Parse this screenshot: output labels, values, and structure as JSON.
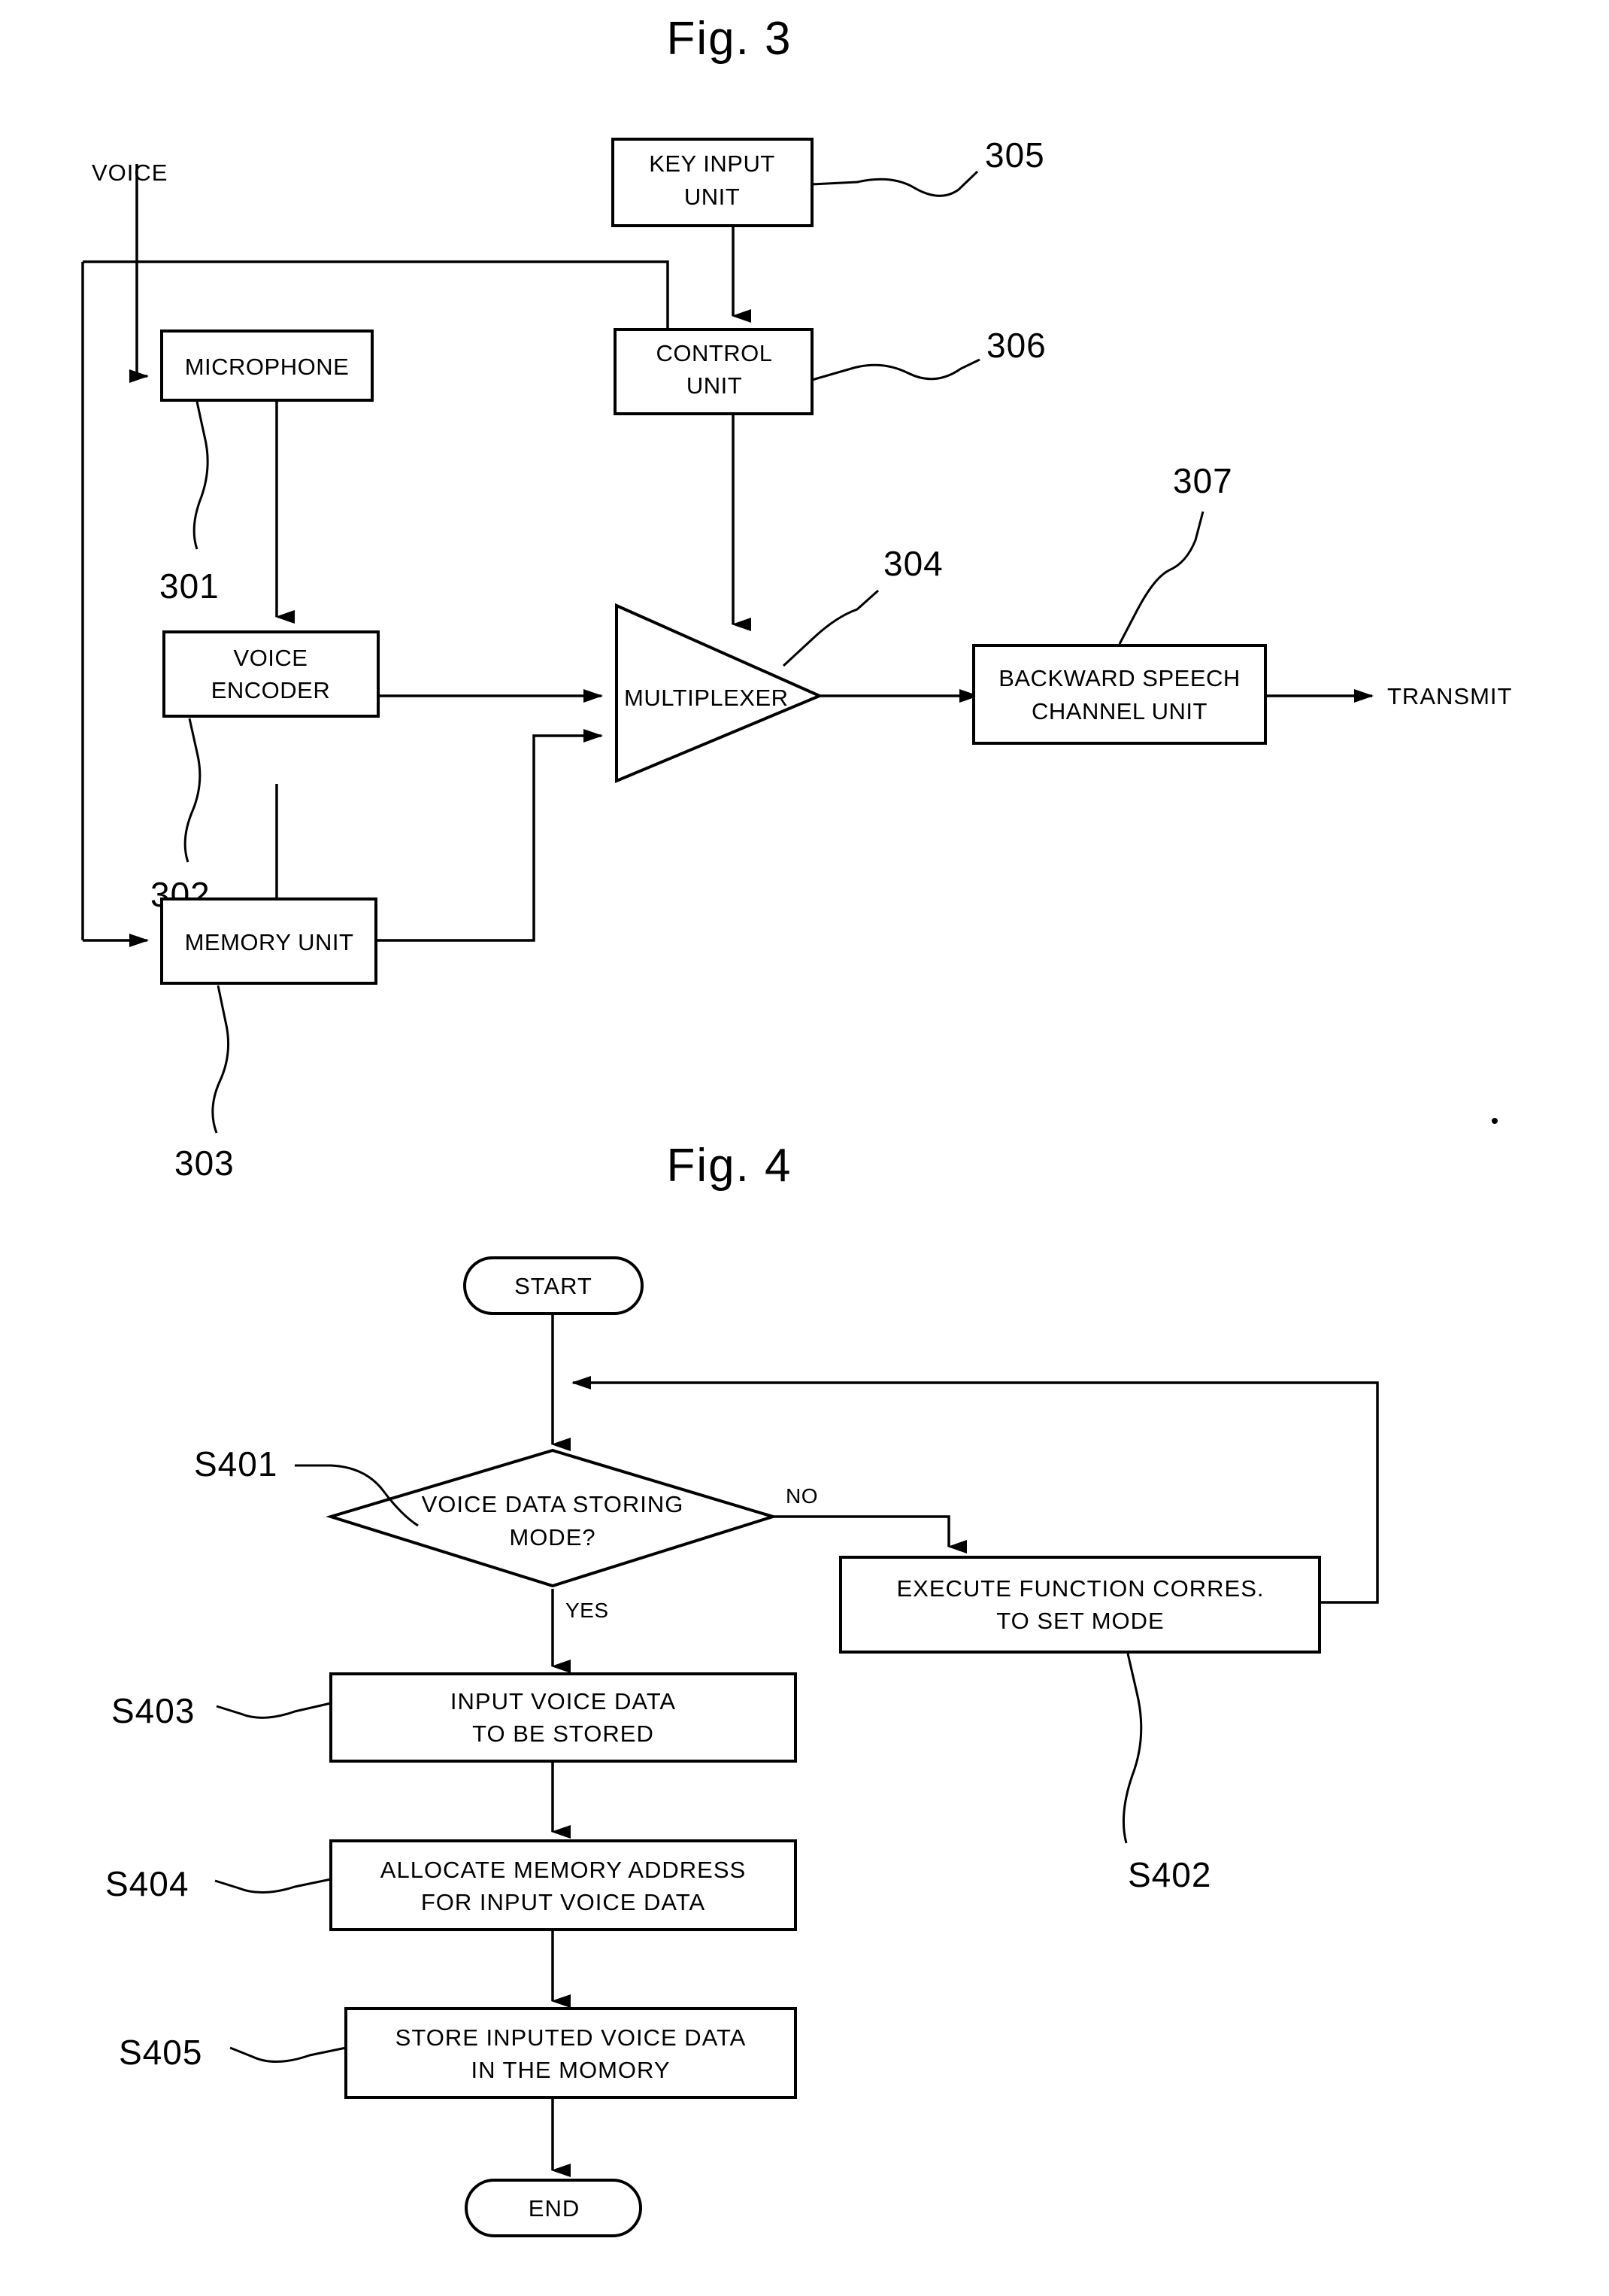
{
  "figures": [
    {
      "title": "Fig. 3",
      "type": "block-diagram",
      "external_labels": {
        "voice_input": "VOICE",
        "transmit_output": "TRANSMIT"
      },
      "blocks": [
        {
          "id": "microphone",
          "label_line1": "MICROPHONE",
          "label_line2": "",
          "ref": "301"
        },
        {
          "id": "voice-encoder",
          "label_line1": "VOICE",
          "label_line2": "ENCODER",
          "ref": "302"
        },
        {
          "id": "memory-unit",
          "label_line1": "MEMORY UNIT",
          "label_line2": "",
          "ref": "303"
        },
        {
          "id": "multiplexer",
          "label_line1": "MULTIPLEXER",
          "label_line2": "",
          "ref": "304"
        },
        {
          "id": "key-input-unit",
          "label_line1": "KEY INPUT",
          "label_line2": "UNIT",
          "ref": "305"
        },
        {
          "id": "control-unit",
          "label_line1": "CONTROL",
          "label_line2": "UNIT",
          "ref": "306"
        },
        {
          "id": "backward-speech",
          "label_line1": "BACKWARD SPEECH",
          "label_line2": "CHANNEL UNIT",
          "ref": "307"
        }
      ]
    },
    {
      "title": "Fig. 4",
      "type": "flowchart",
      "nodes": [
        {
          "id": "start",
          "shape": "terminator",
          "label_line1": "START",
          "label_line2": "",
          "ref": ""
        },
        {
          "id": "decision",
          "shape": "decision",
          "label_line1": "VOICE DATA STORING",
          "label_line2": "MODE?",
          "ref": "S401"
        },
        {
          "id": "execute-function",
          "shape": "process",
          "label_line1": "EXECUTE FUNCTION CORRES.",
          "label_line2": "TO SET MODE",
          "ref": "S402"
        },
        {
          "id": "input-voice",
          "shape": "process",
          "label_line1": "INPUT VOICE DATA",
          "label_line2": "TO BE STORED",
          "ref": "S403"
        },
        {
          "id": "allocate-memory",
          "shape": "process",
          "label_line1": "ALLOCATE MEMORY ADDRESS",
          "label_line2": "FOR INPUT VOICE DATA",
          "ref": "S404"
        },
        {
          "id": "store-voice",
          "shape": "process",
          "label_line1": "STORE INPUTED VOICE DATA",
          "label_line2": "IN THE MOMORY",
          "ref": "S405"
        },
        {
          "id": "end",
          "shape": "terminator",
          "label_line1": "END",
          "label_line2": "",
          "ref": ""
        }
      ],
      "branch_labels": {
        "no": "NO",
        "yes": "YES"
      }
    }
  ],
  "colors": {
    "ink": "#000000",
    "paper": "#ffffff"
  }
}
